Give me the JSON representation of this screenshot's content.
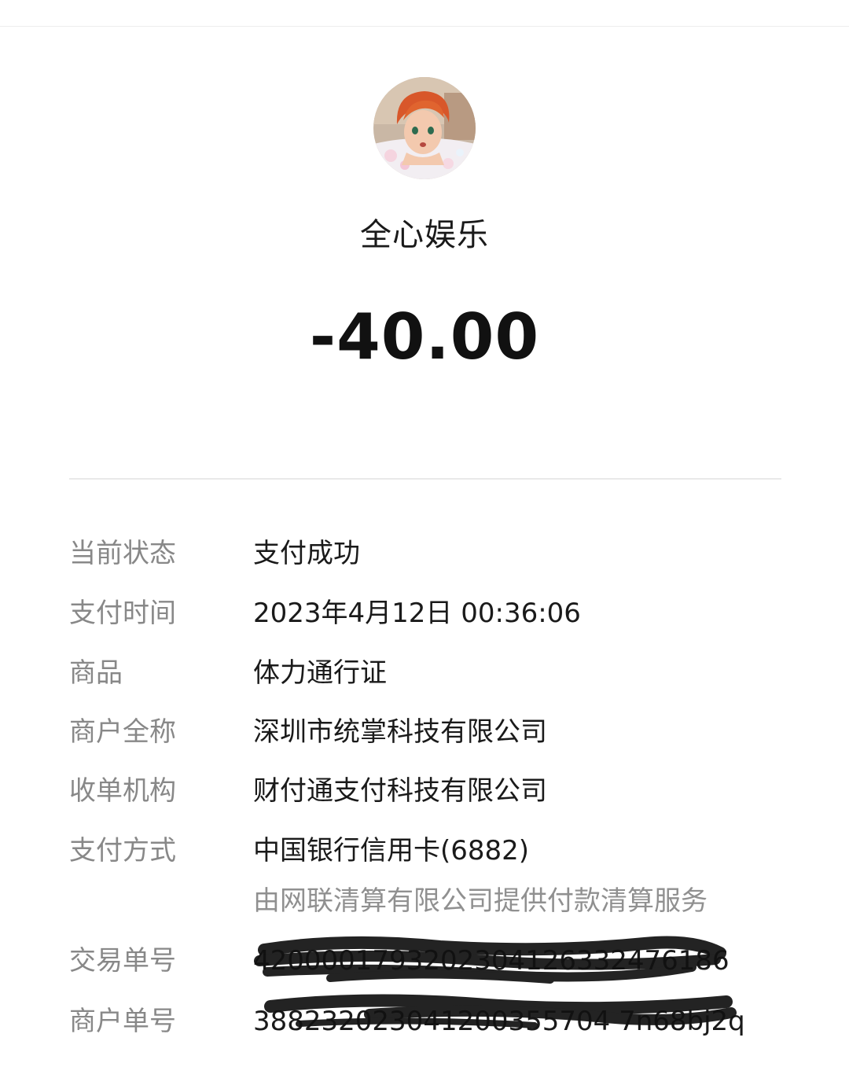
{
  "merchant_name": "全心娱乐",
  "amount": "-40.00",
  "details": [
    {
      "label": "当前状态",
      "value": "支付成功"
    },
    {
      "label": "支付时间",
      "value": "2023年4月12日 00:36:06"
    },
    {
      "label": "商品",
      "value": "体力通行证"
    },
    {
      "label": "商户全称",
      "value": "深圳市统掌科技有限公司"
    },
    {
      "label": "收单机构",
      "value": "财付通支付科技有限公司"
    },
    {
      "label": "支付方式",
      "value": "中国银行信用卡(6882)"
    }
  ],
  "clearing_note": "由网联清算有限公司提供付款清算服务",
  "transaction_no": {
    "label": "交易单号",
    "value": "4200001793202304126332476186"
  },
  "merchant_order_no": {
    "label": "商户单号",
    "value": "388232023041200355704 7n68bj2q"
  }
}
